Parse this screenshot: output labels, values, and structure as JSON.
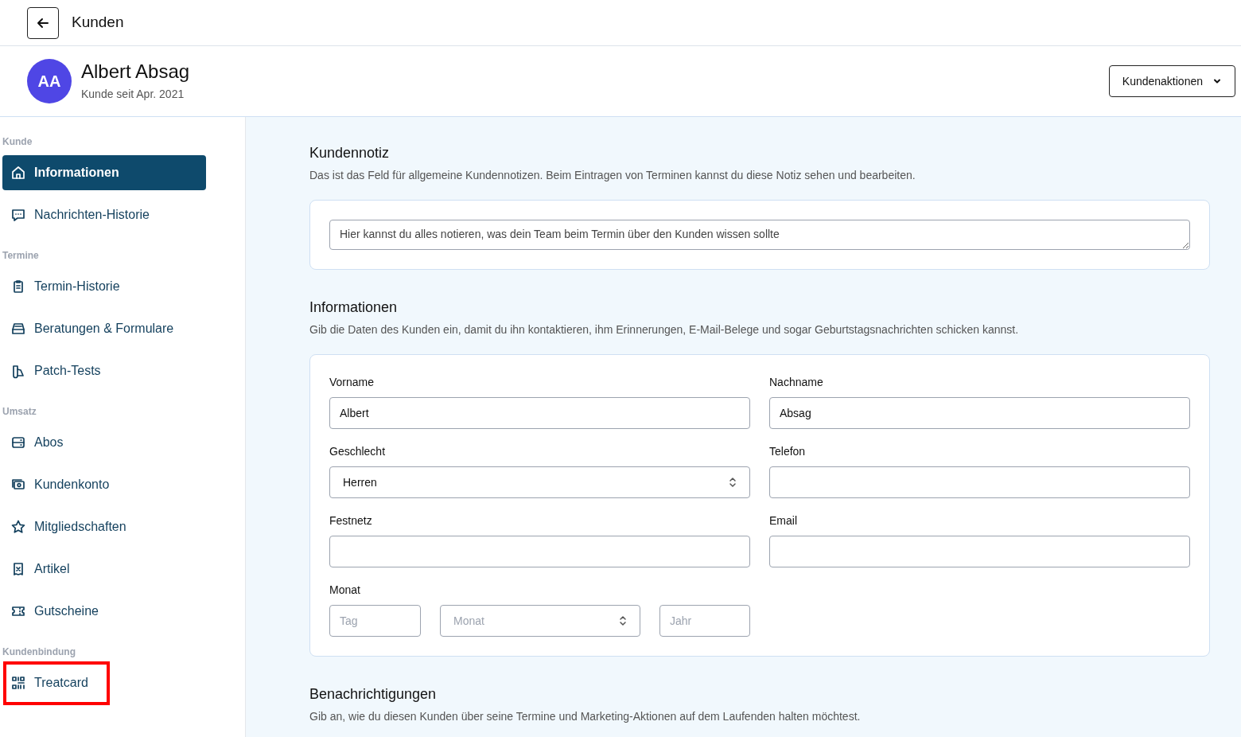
{
  "topbar": {
    "title": "Kunden"
  },
  "profile": {
    "initials": "AA",
    "name": "Albert Absag",
    "since": "Kunde seit Apr. 2021",
    "actions_button": "Kundenaktionen"
  },
  "sidebar": {
    "sections": [
      {
        "title": "Kunde",
        "items": [
          {
            "label": "Informationen",
            "kind": "home",
            "selected": true,
            "highlighted": false
          },
          {
            "label": "Nachrichten-Historie",
            "kind": "chat",
            "selected": false,
            "highlighted": false
          }
        ]
      },
      {
        "title": "Termine",
        "items": [
          {
            "label": "Termin-Historie",
            "kind": "clipboard",
            "selected": false,
            "highlighted": false
          },
          {
            "label": "Beratungen & Formulare",
            "kind": "tray",
            "selected": false,
            "highlighted": false
          },
          {
            "label": "Patch-Tests",
            "kind": "swatch",
            "selected": false,
            "highlighted": false
          }
        ]
      },
      {
        "title": "Umsatz",
        "items": [
          {
            "label": "Abos",
            "kind": "server",
            "selected": false,
            "highlighted": false
          },
          {
            "label": "Kundenkonto",
            "kind": "cash",
            "selected": false,
            "highlighted": false
          },
          {
            "label": "Mitgliedschaften",
            "kind": "star",
            "selected": false,
            "highlighted": false
          },
          {
            "label": "Artikel",
            "kind": "receipt",
            "selected": false,
            "highlighted": false
          },
          {
            "label": "Gutscheine",
            "kind": "ticket",
            "selected": false,
            "highlighted": false
          }
        ]
      },
      {
        "title": "Kundenbindung",
        "items": [
          {
            "label": "Treatcard",
            "kind": "qr",
            "selected": false,
            "highlighted": true
          }
        ]
      }
    ]
  },
  "note": {
    "title": "Kundennotiz",
    "description": "Das ist das Feld für allgemeine Kundennotizen. Beim Eintragen von Terminen kannst du diese Notiz sehen und bearbeiten.",
    "placeholder": "Hier kannst du alles notieren, was dein Team beim Termin über den Kunden wissen sollte"
  },
  "info": {
    "title": "Informationen",
    "description": "Gib die Daten des Kunden ein, damit du ihn kontaktieren, ihm Erinnerungen, E-Mail-Belege und sogar Geburtstagsnachrichten schicken kannst.",
    "fields": [
      {
        "label": "Vorname",
        "kind": "text",
        "value": "Albert"
      },
      {
        "label": "Nachname",
        "kind": "text",
        "value": "Absag"
      },
      {
        "label": "Geschlecht",
        "kind": "select",
        "value": "Herren"
      },
      {
        "label": "Telefon",
        "kind": "text"
      },
      {
        "label": "Festnetz",
        "kind": "text"
      },
      {
        "label": "Email",
        "kind": "text"
      }
    ],
    "birthday": {
      "label": "Monat",
      "day_placeholder": "Tag",
      "month_placeholder": "Monat",
      "year_placeholder": "Jahr"
    }
  },
  "notifications": {
    "title": "Benachrichtigungen",
    "description": "Gib an, wie du diesen Kunden über seine Termine und Marketing-Aktionen auf dem Laufenden halten möchtest."
  }
}
